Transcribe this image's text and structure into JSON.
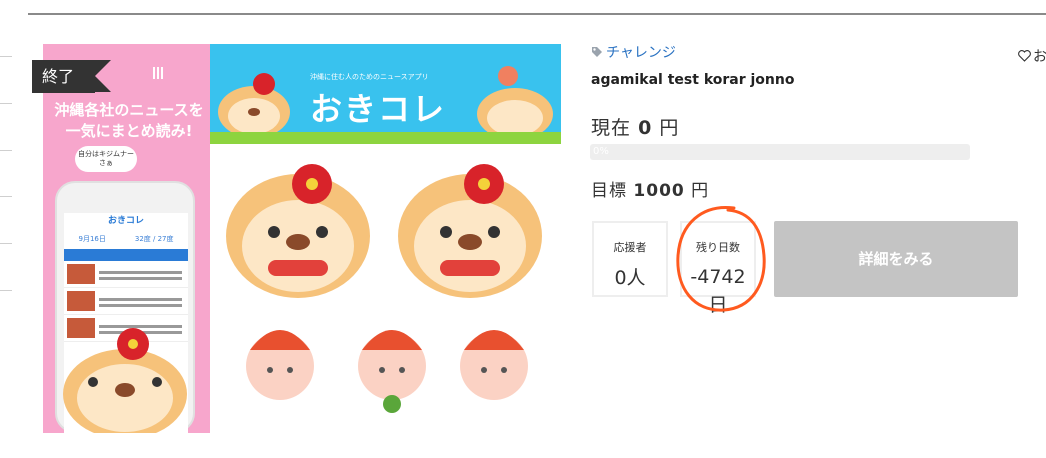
{
  "project": {
    "status_badge": "終了",
    "category": "チャレンジ",
    "title": "agamikal test korar jonno",
    "favorite_label": "お",
    "current_label": "現在",
    "current_amount": "0",
    "currency": "円",
    "progress_percent": "0%",
    "goal_label": "目標",
    "goal_amount": "1000",
    "stats": {
      "supporters_label": "応援者",
      "supporters_value": "0人",
      "days_left_label": "残り日数",
      "days_left_value": "-4742日"
    },
    "detail_button": "詳細をみる"
  },
  "thumbnail": {
    "promo_text": "沖縄各社のニュースを一気にまとめ読み!",
    "bubble_text": "自分はキジムナーさぁ",
    "app_title": "おきコレ",
    "banner_sub": "沖縄に住む人のためのニュースアプリ",
    "phone_date": "9月16日",
    "phone_temp": "32度 / 27度"
  },
  "colors": {
    "accent_link": "#2a72c2",
    "button_disabled": "#c4c4c4",
    "badge_bg": "#333333",
    "thumb_pink": "#f7a6cc",
    "thumb_blue": "#39c2ee",
    "annotation": "#ff5a1f"
  }
}
